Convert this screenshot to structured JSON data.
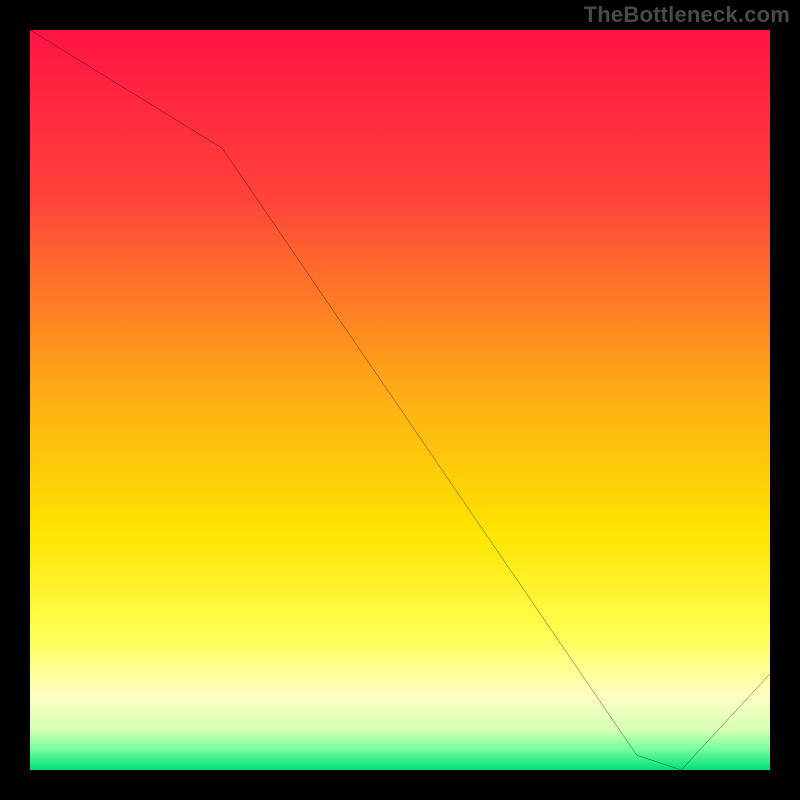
{
  "watermark": "TheBottleneck.com",
  "chart_data": {
    "type": "line",
    "title": "",
    "xlabel": "",
    "ylabel": "",
    "xlim": [
      0,
      100
    ],
    "ylim": [
      0,
      100
    ],
    "x": [
      0,
      26,
      82,
      88,
      100
    ],
    "values": [
      100,
      84,
      2,
      0,
      13
    ],
    "grid": false,
    "legend": false,
    "annotation_text": "",
    "annotation_color": "#ff0000",
    "gradient_stops": [
      {
        "offset": 0,
        "color": "#ff1444"
      },
      {
        "offset": 22,
        "color": "#ff413a"
      },
      {
        "offset": 50,
        "color": "#ffb014"
      },
      {
        "offset": 68,
        "color": "#ffe400"
      },
      {
        "offset": 82,
        "color": "#ffff55"
      },
      {
        "offset": 90,
        "color": "#ffffc4"
      },
      {
        "offset": 94.5,
        "color": "#d7ffb4"
      },
      {
        "offset": 97,
        "color": "#7dffa0"
      },
      {
        "offset": 100,
        "color": "#00e078"
      }
    ]
  }
}
